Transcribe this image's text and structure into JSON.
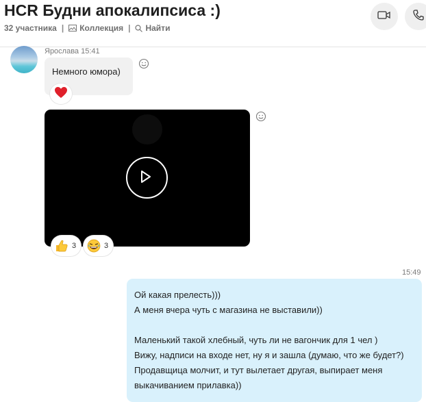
{
  "header": {
    "title": "HCR Будни апокалипсиса :)",
    "participants": "32 участника",
    "collection": "Коллекция",
    "search": "Найти",
    "separator": "|"
  },
  "messages": [
    {
      "sender": "Ярослава",
      "time": "15:41",
      "text": "Немного юмора)",
      "reactions": [
        {
          "icon": "heart-icon"
        }
      ]
    },
    {
      "type": "video",
      "reactions": [
        {
          "icon": "thumbs-up-icon",
          "count": "3"
        },
        {
          "icon": "laughing-face-icon",
          "count": "3"
        }
      ]
    },
    {
      "time": "15:49",
      "lines": [
        "Ой какая прелесть)))",
        "А меня вчера чуть с магазина не выставили))",
        "",
        "Маленький такой хлебный, чуть ли не вагончик для 1 чел )",
        "Вижу, надписи на входе нет, ну я и зашла (думаю, что же будет?)",
        "Продавщица молчит, и тут вылетает другая, выпирает меня",
        "выкачиванием прилавка))"
      ]
    }
  ]
}
